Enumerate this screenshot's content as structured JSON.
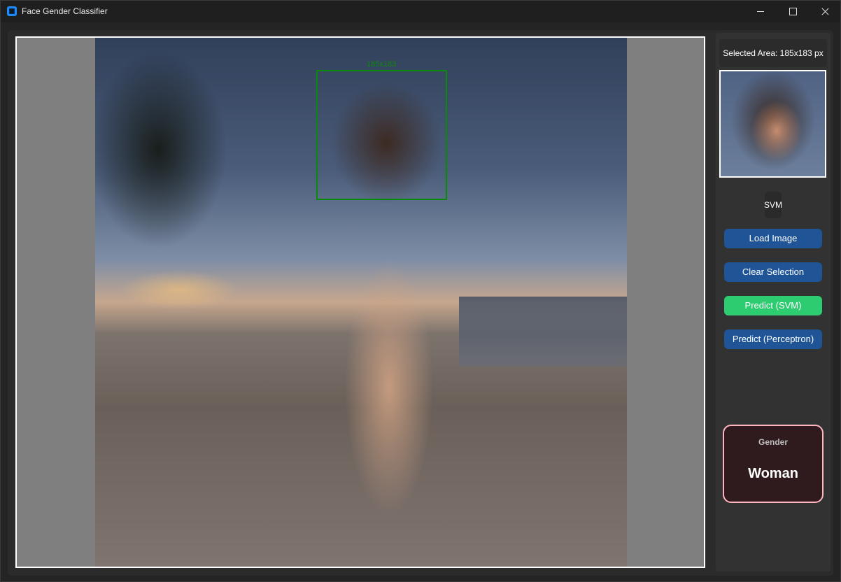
{
  "window": {
    "title": "Face Gender Classifier"
  },
  "selection": {
    "overlay_label": "185x183",
    "selected_area_text": "Selected Area: 185x183 px"
  },
  "model": {
    "selected": "SVM"
  },
  "buttons": {
    "load_image": "Load Image",
    "clear_selection": "Clear Selection",
    "predict_svm": "Predict (SVM)",
    "predict_perceptron": "Predict (Perceptron)"
  },
  "result": {
    "label": "Gender",
    "value": "Woman"
  },
  "colors": {
    "selection_box": "#0a8a0a",
    "primary_button": "#1f5597",
    "active_button": "#2ecc71",
    "result_border": "#ffb6c1"
  },
  "icons": {
    "app": "app-icon",
    "minimize": "minimize-icon",
    "maximize": "maximize-icon",
    "close": "close-icon"
  }
}
